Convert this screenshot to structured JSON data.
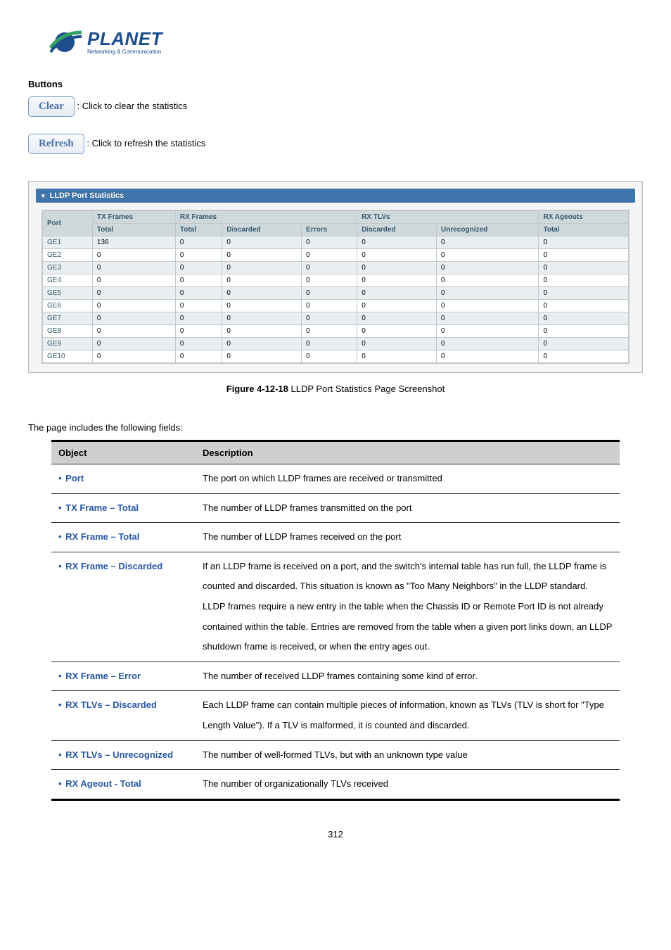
{
  "logo": {
    "name": "PLANET",
    "tagline": "Networking & Communication"
  },
  "buttons_header": "Buttons",
  "clear_btn": "Clear",
  "clear_desc": ": Click to clear the statistics",
  "refresh_btn": "Refresh",
  "refresh_desc": ": Click to refresh the statistics",
  "stats_title": "LLDP Port Statistics",
  "stats_headers": {
    "port": "Port",
    "tx_frames": "TX Frames",
    "rx_frames": "RX Frames",
    "rx_tlvs": "RX TLVs",
    "rx_ageouts": "RX Ageouts",
    "total": "Total",
    "discarded": "Discarded",
    "errors": "Errors",
    "unrecognized": "Unrecognized"
  },
  "stats_rows": [
    {
      "port": "GE1",
      "tx_total": "136",
      "rx_total": "0",
      "rx_disc": "0",
      "rx_err": "0",
      "tlv_disc": "0",
      "tlv_unrec": "0",
      "age_total": "0"
    },
    {
      "port": "GE2",
      "tx_total": "0",
      "rx_total": "0",
      "rx_disc": "0",
      "rx_err": "0",
      "tlv_disc": "0",
      "tlv_unrec": "0",
      "age_total": "0"
    },
    {
      "port": "GE3",
      "tx_total": "0",
      "rx_total": "0",
      "rx_disc": "0",
      "rx_err": "0",
      "tlv_disc": "0",
      "tlv_unrec": "0",
      "age_total": "0"
    },
    {
      "port": "GE4",
      "tx_total": "0",
      "rx_total": "0",
      "rx_disc": "0",
      "rx_err": "0",
      "tlv_disc": "0",
      "tlv_unrec": "0",
      "age_total": "0"
    },
    {
      "port": "GE5",
      "tx_total": "0",
      "rx_total": "0",
      "rx_disc": "0",
      "rx_err": "0",
      "tlv_disc": "0",
      "tlv_unrec": "0",
      "age_total": "0"
    },
    {
      "port": "GE6",
      "tx_total": "0",
      "rx_total": "0",
      "rx_disc": "0",
      "rx_err": "0",
      "tlv_disc": "0",
      "tlv_unrec": "0",
      "age_total": "0"
    },
    {
      "port": "GE7",
      "tx_total": "0",
      "rx_total": "0",
      "rx_disc": "0",
      "rx_err": "0",
      "tlv_disc": "0",
      "tlv_unrec": "0",
      "age_total": "0"
    },
    {
      "port": "GE8",
      "tx_total": "0",
      "rx_total": "0",
      "rx_disc": "0",
      "rx_err": "0",
      "tlv_disc": "0",
      "tlv_unrec": "0",
      "age_total": "0"
    },
    {
      "port": "GE9",
      "tx_total": "0",
      "rx_total": "0",
      "rx_disc": "0",
      "rx_err": "0",
      "tlv_disc": "0",
      "tlv_unrec": "0",
      "age_total": "0"
    },
    {
      "port": "GE10",
      "tx_total": "0",
      "rx_total": "0",
      "rx_disc": "0",
      "rx_err": "0",
      "tlv_disc": "0",
      "tlv_unrec": "0",
      "age_total": "0"
    }
  ],
  "figure_num": "Figure 4-12-18",
  "figure_cap": " LLDP Port Statistics Page Screenshot",
  "fields_intro": "The page includes the following fields:",
  "desc_headers": {
    "object": "Object",
    "description": "Description"
  },
  "desc_rows": [
    {
      "object": "Port",
      "desc": "The port on which LLDP frames are received or transmitted"
    },
    {
      "object": "TX Frame – Total",
      "desc": "The number of LLDP frames transmitted on the port"
    },
    {
      "object": "RX Frame – Total",
      "desc": "The number of LLDP frames received on the port"
    },
    {
      "object": "RX Frame – Discarded",
      "desc": "If an LLDP frame is received on a port, and the switch's internal table has run full, the LLDP frame is counted and discarded. This situation is known as \"Too Many Neighbors\" in the LLDP standard. LLDP frames require a new entry in the table when the Chassis ID or Remote Port ID is not already contained within the table. Entries are removed from the table when a given port links down, an LLDP shutdown frame is received, or when the entry ages out."
    },
    {
      "object": "RX Frame – Error",
      "desc": "The number of received LLDP frames containing some kind of error."
    },
    {
      "object": "RX TLVs – Discarded",
      "desc": "Each LLDP frame can contain multiple pieces of information, known as TLVs (TLV is short for \"Type Length Value\"). If a TLV is malformed, it is counted and discarded."
    },
    {
      "object": "RX TLVs – Unrecognized",
      "desc": "The number of well-formed TLVs, but with an unknown type value"
    },
    {
      "object": "RX Ageout - Total",
      "desc": "The number of organizationally TLVs received"
    }
  ],
  "page_number": "312"
}
